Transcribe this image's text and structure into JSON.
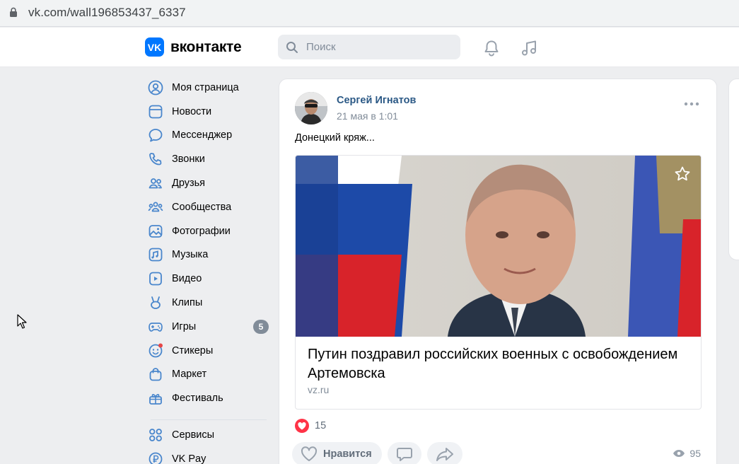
{
  "browser": {
    "url": "vk.com/wall196853437_6337"
  },
  "header": {
    "logo_text": "вконтакте",
    "logo_mark": "VK",
    "search_placeholder": "Поиск"
  },
  "nav": {
    "items": [
      {
        "label": "Моя страница",
        "icon": "profile-icon"
      },
      {
        "label": "Новости",
        "icon": "news-icon"
      },
      {
        "label": "Мессенджер",
        "icon": "messenger-icon"
      },
      {
        "label": "Звонки",
        "icon": "phone-icon"
      },
      {
        "label": "Друзья",
        "icon": "friends-icon"
      },
      {
        "label": "Сообщества",
        "icon": "communities-icon"
      },
      {
        "label": "Фотографии",
        "icon": "photos-icon"
      },
      {
        "label": "Музыка",
        "icon": "music-icon"
      },
      {
        "label": "Видео",
        "icon": "video-icon"
      },
      {
        "label": "Клипы",
        "icon": "clips-icon"
      },
      {
        "label": "Игры",
        "icon": "games-icon",
        "badge": "5"
      },
      {
        "label": "Стикеры",
        "icon": "stickers-icon"
      },
      {
        "label": "Маркет",
        "icon": "market-icon"
      },
      {
        "label": "Фестиваль",
        "icon": "festival-icon"
      }
    ],
    "secondary": [
      {
        "label": "Сервисы",
        "icon": "services-icon"
      },
      {
        "label": "VK Pay",
        "icon": "vkpay-icon"
      }
    ]
  },
  "post": {
    "author": "Сергей Игнатов",
    "time": "21 мая в 1:01",
    "text": "Донецкий кряж...",
    "snippet": {
      "title": "Путин поздравил российских военных с освобождением Артемовска",
      "source": "vz.ru"
    },
    "likes": "15",
    "like_label": "Нравится",
    "views": "95"
  },
  "colors": {
    "accent": "#0077ff",
    "link": "#2a5885",
    "like": "#ff3347",
    "background": "#edeef0"
  }
}
